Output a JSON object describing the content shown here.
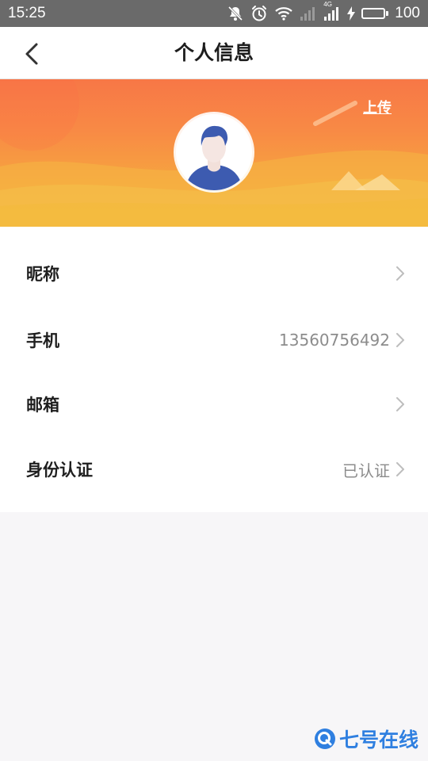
{
  "status_bar": {
    "time": "15:25",
    "network_label": "4G",
    "battery_level": "100"
  },
  "navbar": {
    "title": "个人信息"
  },
  "banner": {
    "upload_label": "上传"
  },
  "rows": [
    {
      "label": "昵称",
      "value": ""
    },
    {
      "label": "手机",
      "value": "13560756492"
    },
    {
      "label": "邮箱",
      "value": ""
    },
    {
      "label": "身份认证",
      "value": "已认证"
    }
  ],
  "watermark": {
    "text": "七号在线"
  },
  "colors": {
    "banner_top": "#f77746",
    "banner_bottom": "#f4b53c",
    "avatar_shirt": "#3d5bb0",
    "watermark": "#2f7fe0"
  }
}
